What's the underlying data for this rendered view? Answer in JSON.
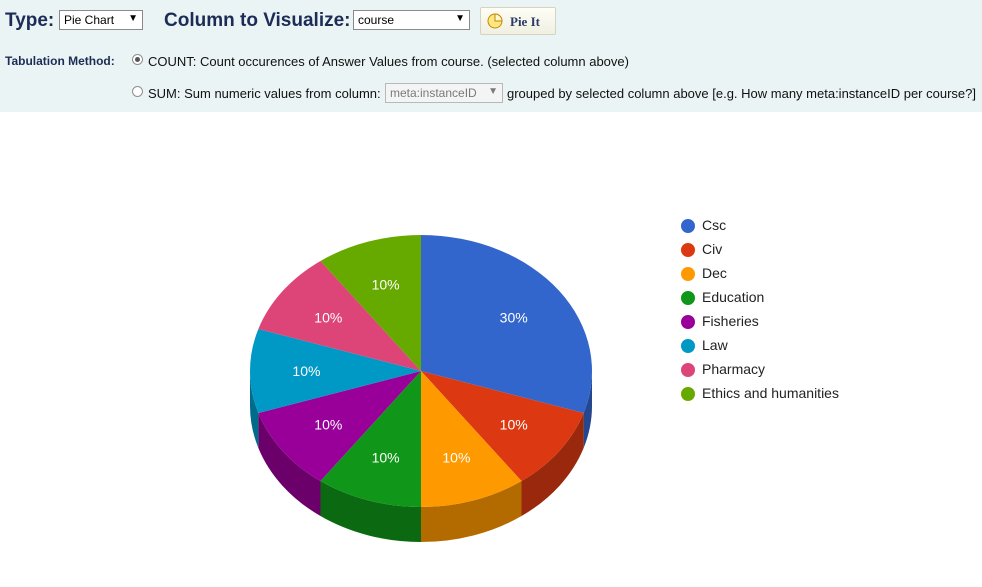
{
  "toolbar": {
    "type_label": "Type:",
    "type_value": "Pie Chart",
    "column_label": "Column to Visualize:",
    "column_value": "course",
    "pie_button_label": "Pie It"
  },
  "tabulation": {
    "label": "Tabulation Method:",
    "count_option": "COUNT: Count occurences of Answer Values from course. (selected column above)",
    "count_selected": true,
    "sum_prefix": "SUM: Sum numeric values from column:",
    "sum_column_value": "meta:instanceID",
    "sum_suffix": "grouped by selected column above [e.g. How many meta:instanceID per course?]"
  },
  "chart_data": {
    "type": "pie",
    "style": "3d",
    "categories": [
      "Csc",
      "Civ",
      "Dec",
      "Education",
      "Fisheries",
      "Law",
      "Pharmacy",
      "Ethics and humanities"
    ],
    "values": [
      30,
      10,
      10,
      10,
      10,
      10,
      10,
      10
    ],
    "labels": [
      "30%",
      "10%",
      "10%",
      "10%",
      "10%",
      "10%",
      "10%",
      "10%"
    ],
    "colors": [
      "#3366cc",
      "#dc3912",
      "#ff9900",
      "#109618",
      "#990099",
      "#0099c6",
      "#dd4477",
      "#66aa00"
    ],
    "legend_position": "right"
  }
}
